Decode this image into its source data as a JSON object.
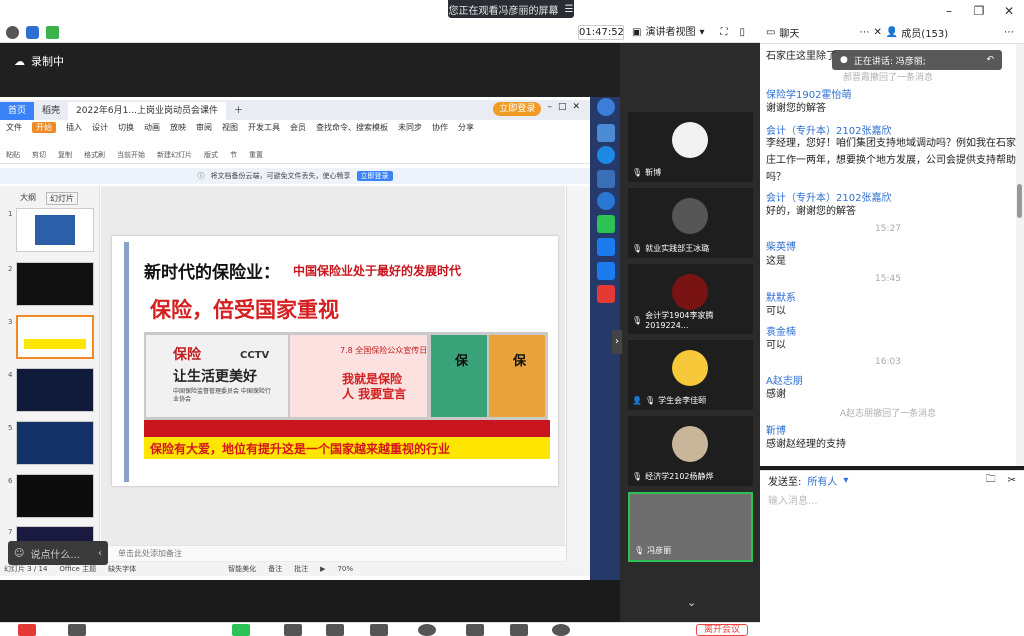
{
  "top": {
    "viewing_notice": "您正在观看冯彦丽的屏幕",
    "timer": "01:47:52",
    "presenter_view": "演讲者视图"
  },
  "recording": {
    "label": "录制中"
  },
  "wps": {
    "tabs": [
      "首页",
      "稻壳",
      "2022年6月1...上岗业岗动员会课件"
    ],
    "login": "立即登录",
    "menu": [
      "文件",
      "开始",
      "插入",
      "设计",
      "切换",
      "动画",
      "放映",
      "审阅",
      "视图",
      "开发工具",
      "会员",
      "查找命令、搜索模板",
      "未同步",
      "协作",
      "分享"
    ],
    "ribbon": [
      "粘贴",
      "剪切",
      "复制",
      "格式刷",
      "当前开始",
      "新建幻灯片",
      "版式",
      "节",
      "重置"
    ],
    "banner_text": "将文档备份云端，可避免文件丢失，使心畅享",
    "banner_btn": "立即登录",
    "panel_tabs": [
      "大纲",
      "幻灯片"
    ],
    "slide_numbers": [
      "1",
      "2",
      "3",
      "4",
      "5",
      "6",
      "7"
    ],
    "notes_placeholder": "单击此处添加备注",
    "status": [
      "幻灯片 3 / 14",
      "Office 主题",
      "缺失字体",
      "智能美化",
      "备注",
      "批注",
      "70%"
    ]
  },
  "slide": {
    "title": "新时代的保险业：",
    "title_red": "中国保险业处于最好的发展时代",
    "subtitle": "保险，倍受国家重视",
    "img1_red": "保险",
    "img1_logo": "CCTV",
    "img1_black": "让生活更美好",
    "img1_small": "中国保险监督管理委员会 中国保险行业协会",
    "img2_top": "7.8 全国保险公众宣传日",
    "img2_main": "我就是保险人 我要宣言",
    "book": "保",
    "banner": "保险有大爱，地位有提升这是一个国家越来越重视的行业"
  },
  "say_something": "说点什么...",
  "gallery": [
    {
      "name": "靳博"
    },
    {
      "name": "就业实践部王冰璐"
    },
    {
      "name": "会计学1904李家腾2019224..."
    },
    {
      "name": "学生会李佳颐"
    },
    {
      "name": "经济学2102杨静烨"
    },
    {
      "name": "冯彦丽"
    }
  ],
  "panel": {
    "chat_tab": "聊天",
    "members_tab": "成员(153)"
  },
  "speaking": "正在讲话: 冯彦丽;",
  "chat": {
    "top_fragment": "石家庄这里除了",
    "sys1": "郝晋霞撤回了一条消息",
    "messages": [
      {
        "who": "保险学1902霍怡萌",
        "text": "谢谢您的解答"
      },
      {
        "who": "会计（专升本）2102张嘉欣",
        "text": "李经理，您好！咱们集团支持地域调动吗？例如我在石家庄工作一两年，想要换个地方发展，公司会提供支持帮助吗？"
      },
      {
        "who": "会计（专升本）2102张嘉欣",
        "text": "好的，谢谢您的解答"
      },
      {
        "who": "柴英博",
        "text": "这是"
      },
      {
        "who": "默默系",
        "text": "可以"
      },
      {
        "who": "袁金楠",
        "text": "可以"
      },
      {
        "who": "A赵志朋",
        "text": "感谢"
      },
      {
        "who": "靳博",
        "text": "感谢赵经理的支持"
      }
    ],
    "times": [
      "15:27",
      "15:45",
      "16:03"
    ],
    "sys2": "A赵志朋撤回了一条消息",
    "send_to_label": "发送至:",
    "send_to_value": "所有人",
    "input_placeholder": "输入消息..."
  },
  "bottom": {
    "end_meeting": "离开会议"
  },
  "colors": {
    "accent": "#2e6fd1",
    "taskbar": "#25396b",
    "slide_red": "#d42020",
    "slide_yellow": "#ffe600"
  }
}
